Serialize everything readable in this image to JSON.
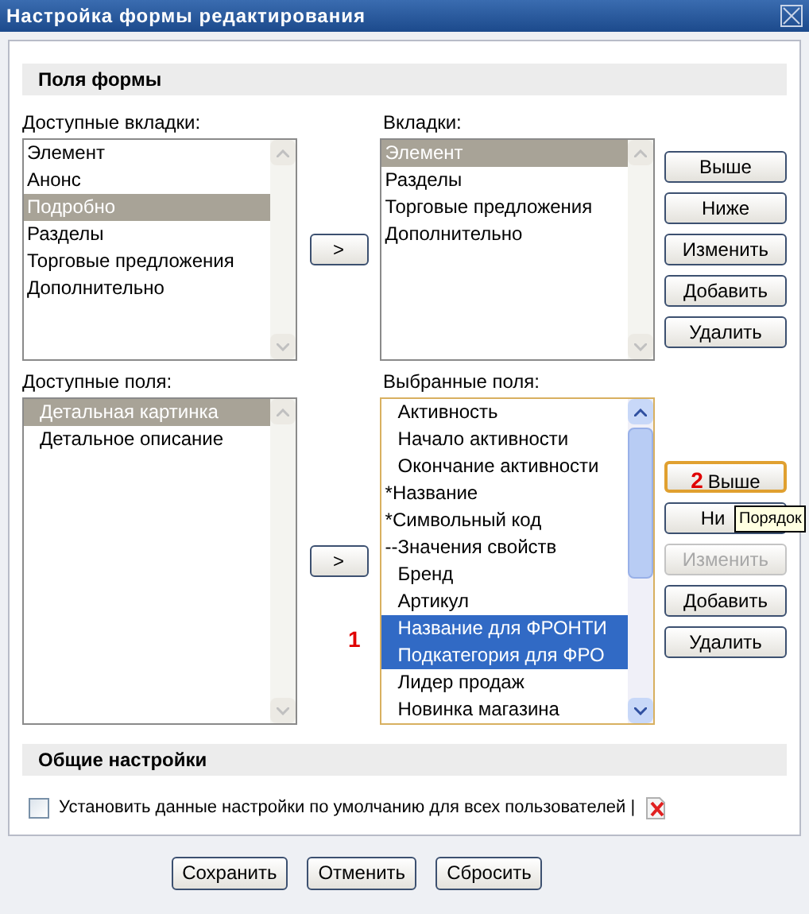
{
  "window": {
    "title": "Настройка формы редактирования"
  },
  "sections": [
    {
      "title": "Поля формы"
    },
    {
      "title": "Общие настройки"
    }
  ],
  "tabs_block": {
    "available_label": "Доступные вкладки:",
    "available": [
      {
        "label": "Элемент",
        "selected": false
      },
      {
        "label": "Анонс",
        "selected": false
      },
      {
        "label": "Подробно",
        "selected": true
      },
      {
        "label": "Разделы",
        "selected": false
      },
      {
        "label": "Торговые предложения",
        "selected": false
      },
      {
        "label": "Дополнительно",
        "selected": false
      }
    ],
    "move_button": ">",
    "chosen_label": "Вкладки:",
    "chosen": [
      {
        "label": "Элемент",
        "selected": true
      },
      {
        "label": "Разделы",
        "selected": false
      },
      {
        "label": "Торговые предложения",
        "selected": false
      },
      {
        "label": "Дополнительно",
        "selected": false
      }
    ],
    "buttons": [
      {
        "label": "Выше",
        "disabled": false,
        "focused": false
      },
      {
        "label": "Ниже",
        "disabled": false,
        "focused": false
      },
      {
        "label": "Изменить",
        "disabled": false,
        "focused": false
      },
      {
        "label": "Добавить",
        "disabled": false,
        "focused": false
      },
      {
        "label": "Удалить",
        "disabled": false,
        "focused": false
      }
    ]
  },
  "fields_block": {
    "available_label": "Доступные поля:",
    "available": [
      {
        "label": "Детальная картинка",
        "selected": true,
        "indented": true
      },
      {
        "label": "Детальное описание",
        "selected": false,
        "indented": true
      }
    ],
    "move_button": ">",
    "chosen_label": "Выбранные поля:",
    "chosen": [
      {
        "label": "Активность",
        "selected": false,
        "indented": true
      },
      {
        "label": "Начало активности",
        "selected": false,
        "indented": true
      },
      {
        "label": "Окончание активности",
        "selected": false,
        "indented": true
      },
      {
        "label": "*Название",
        "selected": false,
        "indented": false
      },
      {
        "label": "*Символьный код",
        "selected": false,
        "indented": false
      },
      {
        "label": "--Значения свойств",
        "selected": false,
        "indented": false
      },
      {
        "label": "Бренд",
        "selected": false,
        "indented": true
      },
      {
        "label": "Артикул",
        "selected": false,
        "indented": true
      },
      {
        "label": "Название для ФРОНТИ",
        "selected": true,
        "indented": true
      },
      {
        "label": "Подкатегория для ФРО",
        "selected": true,
        "indented": true
      },
      {
        "label": "Лидер продаж",
        "selected": false,
        "indented": true
      },
      {
        "label": "Новинка магазина",
        "selected": false,
        "indented": true
      }
    ],
    "buttons": [
      {
        "label": "Выше",
        "disabled": false,
        "focused": true,
        "annotation": "2"
      },
      {
        "label": "Ни",
        "disabled": false,
        "focused": false
      },
      {
        "label": "Изменить",
        "disabled": true,
        "focused": false
      },
      {
        "label": "Добавить",
        "disabled": false,
        "focused": false
      },
      {
        "label": "Удалить",
        "disabled": false,
        "focused": false
      }
    ],
    "annotation": "1",
    "tooltip": "Порядок"
  },
  "general": {
    "checkbox": {
      "label": "Установить данные настройки по умолчанию для всех пользователей |",
      "checked": false
    }
  },
  "footer_buttons": [
    "Сохранить",
    "Отменить",
    "Сбросить"
  ]
}
